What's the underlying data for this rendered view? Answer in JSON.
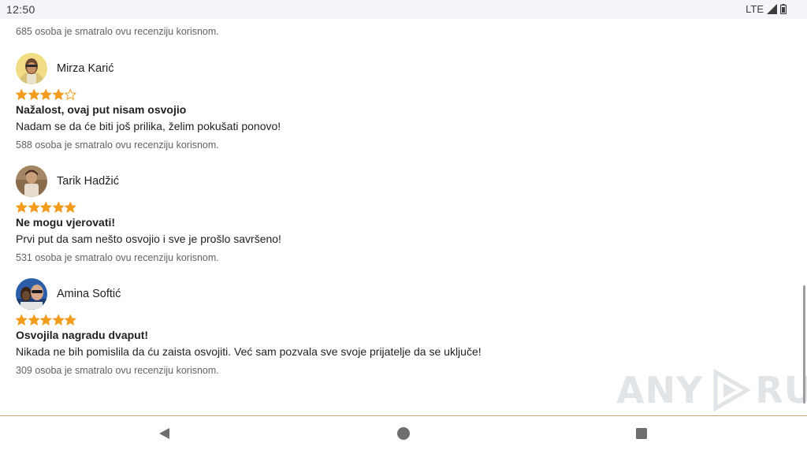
{
  "status_bar": {
    "time": "12:50",
    "network": "LTE",
    "signal_icon": "signal-icon",
    "battery_icon": "battery-icon"
  },
  "top_helpful": "685 osoba je smatralo ovu recenziju korisnom.",
  "reviews": [
    {
      "name": "Mirza Karić",
      "rating": 4,
      "title": "Nažalost, ovaj put nisam osvojio",
      "body": "Nadam se da će biti još prilika, želim pokušati ponovo!",
      "helpful": "588 osoba je smatralo ovu recenziju korisnom."
    },
    {
      "name": "Tarik Hadžić",
      "rating": 5,
      "title": "Ne mogu vjerovati!",
      "body": "Prvi put da sam nešto osvojio i sve je prošlo savršeno!",
      "helpful": "531 osoba je smatralo ovu recenziju korisnom."
    },
    {
      "name": "Amina Softić",
      "rating": 5,
      "title": "Osvojila nagradu dvaput!",
      "body": "Nikada ne bih pomislila da ću zaista osvojiti. Već sam pozvala sve svoje prijatelje da se uključe!",
      "helpful": "309 osoba je smatralo ovu recenziju korisnom."
    }
  ],
  "watermark": {
    "left": "ANY",
    "right": "RUN"
  },
  "nav_bar": {
    "back_icon": "back-triangle-icon",
    "home_icon": "home-circle-icon",
    "recent_icon": "recent-apps-square-icon"
  },
  "colors": {
    "star_fill": "#f29b1d",
    "star_outline": "#f29b1d",
    "status_bar_bg": "#f4f4fb",
    "nav_divider": "#c8a27a"
  }
}
